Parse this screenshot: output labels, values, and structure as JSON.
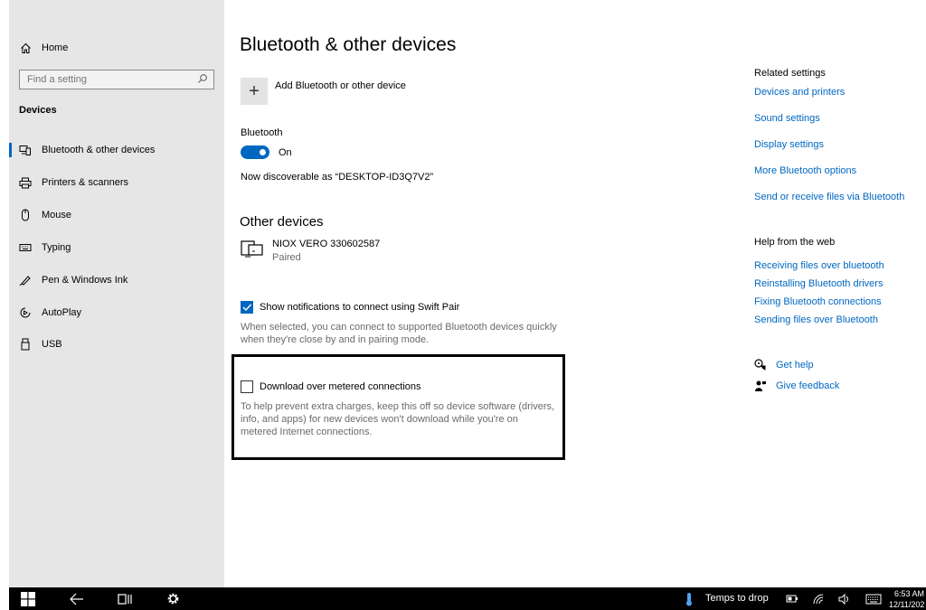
{
  "sidebar": {
    "home_label": "Home",
    "search_placeholder": "Find a setting",
    "section_heading": "Devices",
    "items": [
      {
        "label": "Bluetooth & other devices",
        "icon": "bluetooth-devices-icon",
        "active": true
      },
      {
        "label": "Printers & scanners",
        "icon": "printer-icon"
      },
      {
        "label": "Mouse",
        "icon": "mouse-icon"
      },
      {
        "label": "Typing",
        "icon": "keyboard-icon"
      },
      {
        "label": "Pen & Windows Ink",
        "icon": "pen-icon"
      },
      {
        "label": "AutoPlay",
        "icon": "autoplay-icon"
      },
      {
        "label": "USB",
        "icon": "usb-icon"
      }
    ]
  },
  "main": {
    "title": "Bluetooth & other devices",
    "add_label": "Add Bluetooth or other device",
    "bluetooth_label": "Bluetooth",
    "bluetooth_state": "On",
    "discoverable_text": "Now discoverable as “DESKTOP-ID3Q7V2”",
    "other_devices_heading": "Other devices",
    "device": {
      "name": "NIOX VERO 330602587",
      "status": "Paired"
    },
    "swift_pair": {
      "label": "Show notifications to connect using Swift Pair",
      "checked": true,
      "desc_line1": "When selected, you can connect to supported Bluetooth devices quickly",
      "desc_line2": "when they're close by and in pairing mode."
    },
    "metered": {
      "label": "Download over metered connections",
      "checked": false,
      "desc_line1": "To help prevent extra charges, keep this off so device software (drivers,",
      "desc_line2": "info, and apps) for new devices won't download while you're on",
      "desc_line3": "metered Internet connections."
    }
  },
  "related": {
    "heading": "Related settings",
    "links": [
      "Devices and printers",
      "Sound settings",
      "Display settings",
      "More Bluetooth options",
      "Send or receive files via Bluetooth"
    ]
  },
  "help": {
    "heading": "Help from the web",
    "links": [
      "Receiving files over bluetooth",
      "Reinstalling Bluetooth drivers",
      "Fixing Bluetooth connections",
      "Sending files over Bluetooth"
    ],
    "get_help": "Get help",
    "give_feedback": "Give feedback"
  },
  "taskbar": {
    "weather_text": "Temps to drop",
    "time": "6:53 AM",
    "date": "12/11/202"
  },
  "colors": {
    "accent": "#0067c0",
    "sidebar_bg": "#e6e6e6",
    "taskbar_bg": "#000000"
  }
}
